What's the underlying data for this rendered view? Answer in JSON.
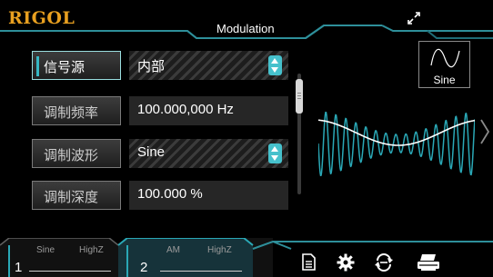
{
  "header": {
    "brand": "RIGOL",
    "title": "Modulation",
    "status_icon": "usb-connected-icon"
  },
  "params": [
    {
      "label": "信号源",
      "value": "内部",
      "control": "dropdown",
      "selected": true
    },
    {
      "label": "调制频率",
      "value": "100.000,000 Hz",
      "control": "numeric"
    },
    {
      "label": "调制波形",
      "value": "Sine",
      "control": "dropdown"
    },
    {
      "label": "调制深度",
      "value": "100.000 %",
      "control": "numeric"
    }
  ],
  "waveform_thumbnail": {
    "label": "Sine",
    "icon": "sine-wave-icon"
  },
  "preview": {
    "icon": "am-modulated-waveform"
  },
  "channels": [
    {
      "number": "1",
      "wave": "Sine",
      "impedance": "HighZ",
      "active": false
    },
    {
      "number": "2",
      "wave": "AM",
      "impedance": "HighZ",
      "active": true
    }
  ],
  "toolbar": [
    "file-icon",
    "gear-icon",
    "sync-icon",
    "print-icon"
  ],
  "colors": {
    "accent": "#35b8c4",
    "brand": "#e8a020",
    "background": "#000000"
  }
}
